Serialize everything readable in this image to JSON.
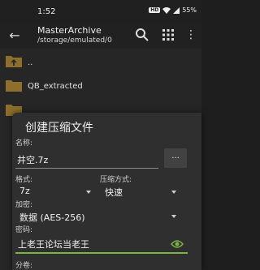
{
  "status_bar": {
    "time": "1:52",
    "battery": "55%",
    "network_badge": "HD"
  },
  "app_bar": {
    "title": "MasterArchive",
    "path": "/storage/emulated/0"
  },
  "file_list": {
    "items": [
      {
        "name": "..",
        "icon": "folder-up-icon",
        "meta": ""
      },
      {
        "name": "QB_extracted",
        "icon": "folder-icon",
        "meta": ""
      },
      {
        "name": "",
        "icon": "folder-icon",
        "meta": ""
      }
    ]
  },
  "dialog": {
    "title": "创建压缩文件",
    "name_label": "名称:",
    "name_value": "井空.7z",
    "browse_label": "...",
    "format_label": "格式:",
    "format_value": "7z",
    "compression_label": "压缩方式:",
    "compression_value": "快速",
    "encryption_label": "加密:",
    "encryption_value": "数据 (AES-256)",
    "password_label": "密码:",
    "password_value": "上老王论坛当老王",
    "split_label": "分卷:"
  },
  "colors": {
    "accent": "#7cb342",
    "folder": "#8d6e2a"
  }
}
